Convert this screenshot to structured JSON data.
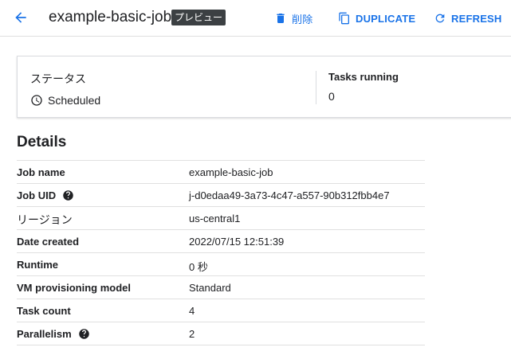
{
  "header": {
    "title": "example-basic-job",
    "badge": "プレビュー",
    "delete_label": "削除",
    "duplicate_label": "DUPLICATE",
    "refresh_label": "REFRESH"
  },
  "status": {
    "status_label": "ステータス",
    "status_value": "Scheduled",
    "tasks_label": "Tasks running",
    "tasks_value": "0"
  },
  "details": {
    "title": "Details",
    "rows": [
      {
        "key": "Job name",
        "value": "example-basic-job"
      },
      {
        "key": "Job UID",
        "value": "j-d0edaa49-3a73-4c47-a557-90b312fbb4e7"
      },
      {
        "key": "リージョン",
        "value": "us-central1"
      },
      {
        "key": "Date created",
        "value": "2022/07/15 12:51:39"
      },
      {
        "key": "Runtime",
        "value": "0 秒"
      },
      {
        "key": "VM provisioning model",
        "value": "Standard"
      },
      {
        "key": "Task count",
        "value": "4"
      },
      {
        "key": "Parallelism",
        "value": "2"
      }
    ]
  },
  "colors": {
    "accent": "#1a73e8",
    "badge_bg": "#3c4043",
    "border": "#dadce0"
  },
  "icons": {
    "back": "arrow-back-icon",
    "delete": "trash-icon",
    "duplicate": "copy-icon",
    "refresh": "refresh-icon",
    "status": "clock-icon",
    "help": "help-icon"
  }
}
